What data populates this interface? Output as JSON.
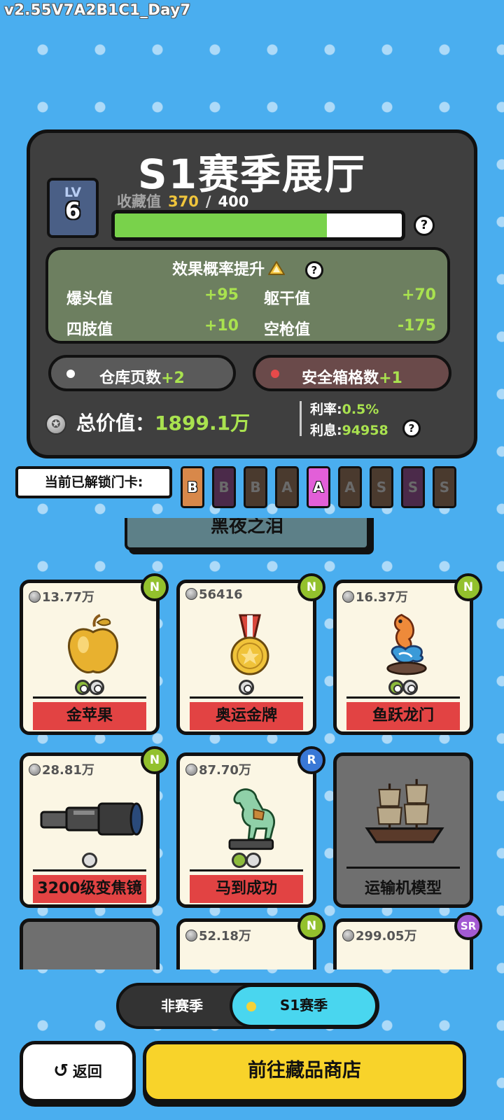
{
  "version": "v2.55V7A2B1C1_Day7",
  "hall": {
    "title": "S1赛季展厅",
    "level_label": "LV",
    "level": "6",
    "collect_label": "收藏值",
    "collect_current": "370",
    "collect_sep": "/",
    "collect_max": "400",
    "progress_fraction": 0.74,
    "help": "?"
  },
  "effects": {
    "title": "效果概率提升",
    "items": [
      {
        "label": "爆头值",
        "value": "+95"
      },
      {
        "label": "躯干值",
        "value": "+70"
      },
      {
        "label": "四肢值",
        "value": "+10"
      },
      {
        "label": "空枪值",
        "value": "-175"
      }
    ]
  },
  "perks": {
    "warehouse_label": "仓库页数",
    "warehouse_value": "+2",
    "safebox_label": "安全箱格数",
    "safebox_value": "+1"
  },
  "totals": {
    "total_label": "总价值：",
    "total_value": "1899.1万",
    "rate_label": "利率:",
    "rate_value": "0.5%",
    "interest_label": "利息:",
    "interest_value": "94958"
  },
  "unlock": {
    "label": "当前已解锁门卡:",
    "cards": [
      {
        "letter": "B",
        "color": "#d8884a",
        "unlocked": true
      },
      {
        "letter": "B",
        "color": "#4b2a4a",
        "unlocked": false
      },
      {
        "letter": "B",
        "color": "#4a3a2e",
        "unlocked": false
      },
      {
        "letter": "A",
        "color": "#4a3a2e",
        "unlocked": false
      },
      {
        "letter": "A",
        "color": "#e25fd8",
        "unlocked": true
      },
      {
        "letter": "A",
        "color": "#4a3a2e",
        "unlocked": false
      },
      {
        "letter": "S",
        "color": "#4a3a2e",
        "unlocked": false
      },
      {
        "letter": "S",
        "color": "#4b2a4a",
        "unlocked": false
      },
      {
        "letter": "S",
        "color": "#4a3a2e",
        "unlocked": false
      }
    ]
  },
  "collection": {
    "category": "黑夜之泪",
    "items": [
      {
        "price": "13.77万",
        "rarity": "N",
        "name": "金苹果"
      },
      {
        "price": "56416",
        "rarity": "N",
        "name": "奥运金牌"
      },
      {
        "price": "16.37万",
        "rarity": "N",
        "name": "鱼跃龙门"
      },
      {
        "price": "28.81万",
        "rarity": "N",
        "name": "3200级变焦镜"
      },
      {
        "price": "87.70万",
        "rarity": "R",
        "name": "马到成功"
      },
      {
        "price": "",
        "rarity": "",
        "name": "运输机模型"
      },
      {
        "price": "",
        "rarity": "",
        "name": ""
      },
      {
        "price": "52.18万",
        "rarity": "N",
        "name": ""
      },
      {
        "price": "299.05万",
        "rarity": "SR",
        "name": ""
      }
    ]
  },
  "season_toggle": {
    "off_label": "非赛季",
    "on_label": "S1赛季"
  },
  "buttons": {
    "back_icon": "↺",
    "back_label": "返回",
    "shop_label": "前往藏品商店"
  },
  "colors": {
    "background": "#4aaeef",
    "progress": "#79d24b",
    "accent_green": "#a9e24f",
    "gold": "#f0c53c",
    "shop_button": "#f8d32a",
    "toggle_active": "#49d6ef",
    "name_bar": "#e24343"
  }
}
